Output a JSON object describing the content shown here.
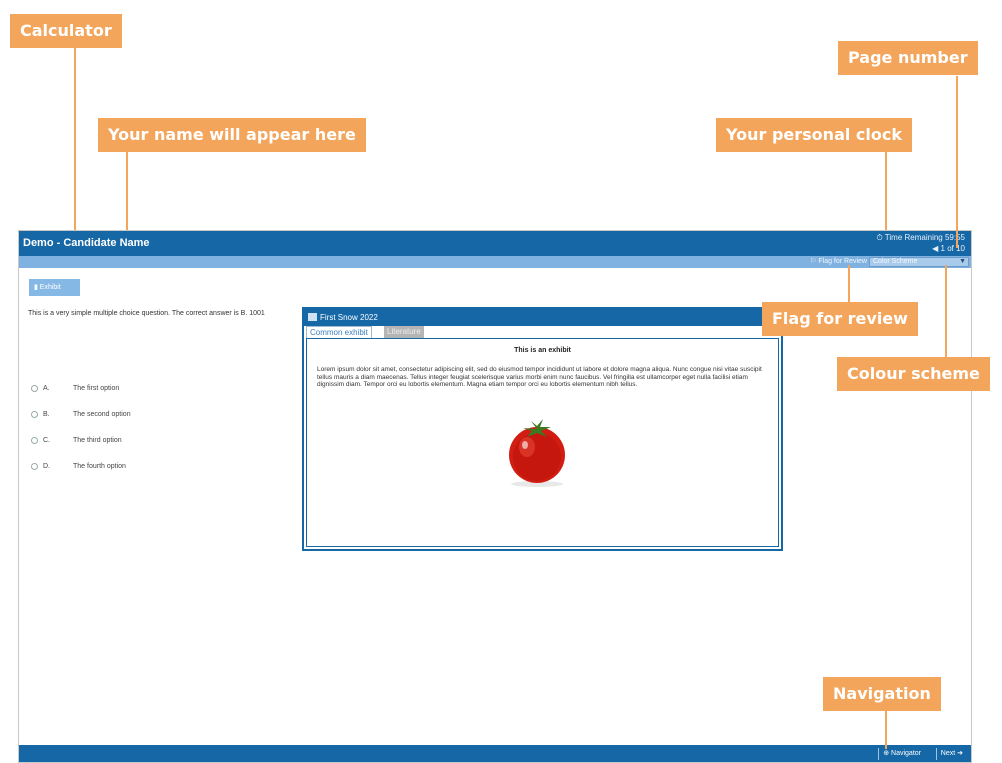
{
  "annotations": {
    "calculator": "Calculator",
    "name": "Your name will appear here",
    "page_number": "Page number",
    "clock": "Your personal clock",
    "flag": "Flag for review",
    "colour_scheme": "Colour scheme",
    "navigation": "Navigation"
  },
  "header": {
    "candidate": "Demo - Candidate Name",
    "time_remaining": "⏱ Time Remaining 59:55",
    "page": "1 of 10"
  },
  "toolbar": {
    "flag_label": "⚐ Flag for Review",
    "color_scheme": "Color Scheme"
  },
  "exhibit_button": "Exhibit",
  "question": {
    "text": "This is a very simple multiple choice question. The correct answer is B. 1001",
    "options": [
      {
        "letter": "A.",
        "text": "The first option"
      },
      {
        "letter": "B.",
        "text": "The second option"
      },
      {
        "letter": "C.",
        "text": "The third option"
      },
      {
        "letter": "D.",
        "text": "The fourth option"
      }
    ]
  },
  "exhibit": {
    "title": "First Snow 2022",
    "tabs": [
      "Common exhibit",
      "Literature"
    ],
    "heading": "This is an exhibit",
    "body": "Lorem ipsum dolor sit amet, consectetur adipiscing elit, sed do eiusmod tempor incididunt ut labore et dolore magna aliqua. Nunc congue nisi vitae suscipit tellus mauris a diam maecenas. Tellus integer feugiat scelerisque varius morbi enim nunc faucibus. Vel fringilla est ullamcorper eget nulla facilisi etiam dignissim diam. Tempor orci eu lobortis elementum. Magna etiam tempor orci eu lobortis elementum nibh tellus."
  },
  "footer": {
    "navigator": "⊕ Navigator",
    "next": "Next ➜"
  },
  "colors": {
    "accent": "#1567a6",
    "callout": "#f3a55c",
    "toolbar": "#7fb2e0"
  }
}
